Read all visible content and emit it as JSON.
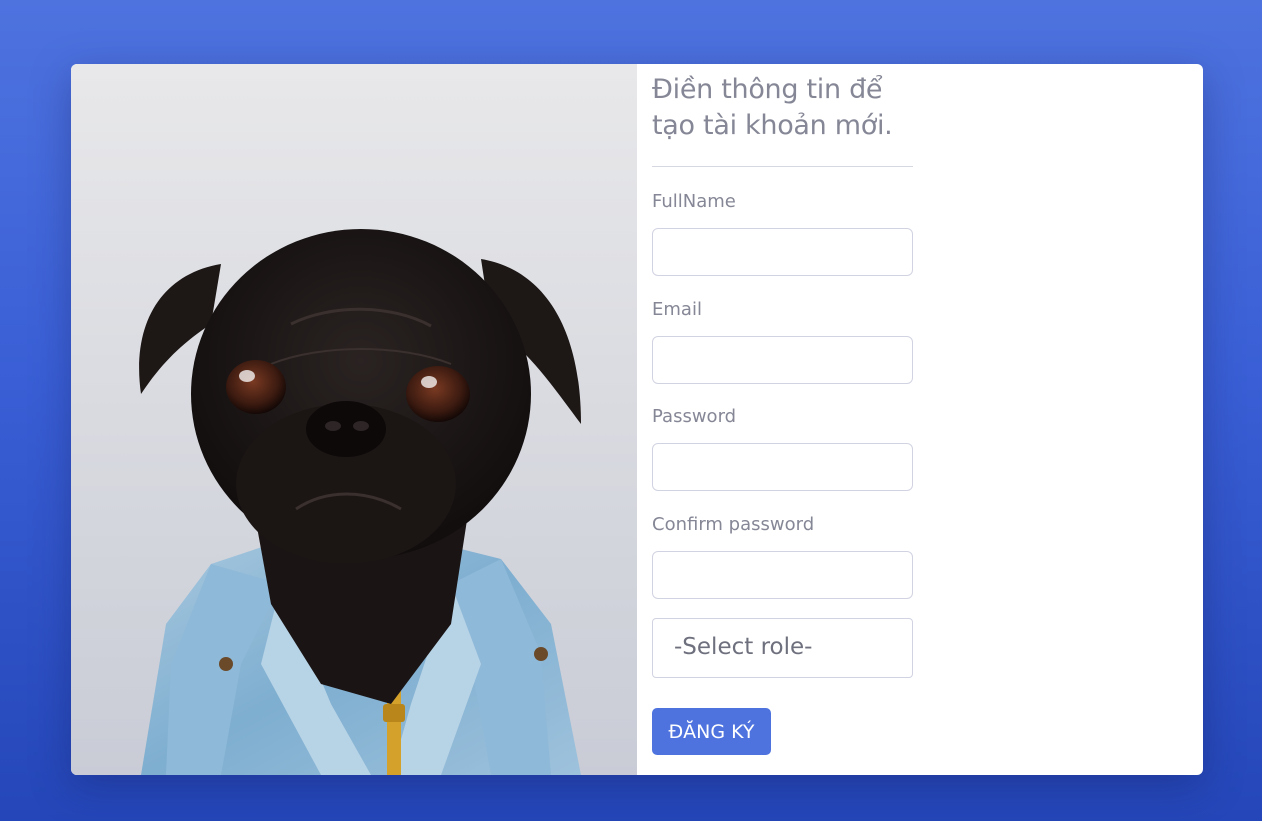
{
  "form": {
    "heading": "Điền thông tin để tạo tài khoản mới.",
    "fields": [
      {
        "label": "FullName",
        "value": ""
      },
      {
        "label": "Email",
        "value": ""
      },
      {
        "label": "Password",
        "value": ""
      },
      {
        "label": "Confirm password",
        "value": ""
      }
    ],
    "role_select": {
      "selected": "-Select role-"
    },
    "submit_label": "ĐĂNG KÝ"
  },
  "colors": {
    "page_background": "#4e73df",
    "primary_button": "#4e73df",
    "text_muted": "#858796"
  },
  "photo": {
    "subject": "pug-in-denim-jacket-photo"
  }
}
